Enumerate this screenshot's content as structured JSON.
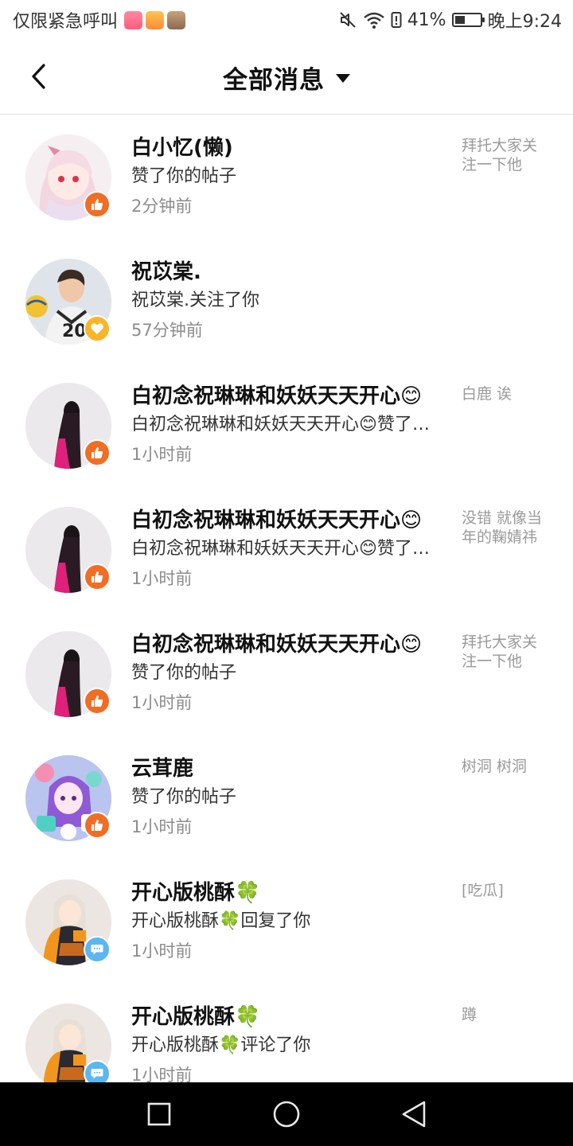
{
  "status_bar": {
    "carrier": "仅限紧急呼叫",
    "battery_percent": "41%",
    "battery_level": 0.41,
    "time": "晚上9:24",
    "notification_icons": [
      "app-notification-icon",
      "app-notification-icon",
      "app-notification-icon"
    ]
  },
  "header": {
    "title": "全部消息"
  },
  "messages": [
    {
      "name": "白小忆(懒)",
      "action": "赞了你的帖子",
      "time": "2分钟前",
      "preview": "拜托大家关注一下他",
      "badge": "like",
      "avatar": "anime-girl-pink-hair"
    },
    {
      "name": "祝苡棠.",
      "action": "祝苡棠.关注了你",
      "time": "57分钟前",
      "preview": "",
      "badge": "follow",
      "avatar": "volleyball-player"
    },
    {
      "name": "白初念祝琳琳和妖妖天天开心😊",
      "action": "白初念祝琳琳和妖妖天天开心😊赞了你的评论",
      "time": "1小时前",
      "preview": "白鹿 诶",
      "badge": "like",
      "avatar": "long-hair-silhouette"
    },
    {
      "name": "白初念祝琳琳和妖妖天天开心😊",
      "action": "白初念祝琳琳和妖妖天天开心😊赞了你的评论",
      "time": "1小时前",
      "preview": "没错 就像当年的鞠婧祎一样",
      "badge": "like",
      "avatar": "long-hair-silhouette"
    },
    {
      "name": "白初念祝琳琳和妖妖天天开心😊",
      "action": "赞了你的帖子",
      "time": "1小时前",
      "preview": "拜托大家关注一下他",
      "badge": "like",
      "avatar": "long-hair-silhouette"
    },
    {
      "name": "云茸鹿",
      "action": "赞了你的帖子",
      "time": "1小时前",
      "preview": "树洞 树洞",
      "badge": "like",
      "avatar": "colorful-anime-collage"
    },
    {
      "name": "开心版桃酥🍀",
      "action": "开心版桃酥🍀回复了你",
      "time": "1小时前",
      "preview": "[吃瓜]",
      "badge": "comment",
      "avatar": "anime-girl-orange-jacket"
    },
    {
      "name": "开心版桃酥🍀",
      "action": "开心版桃酥🍀评论了你",
      "time": "1小时前",
      "preview": "蹲",
      "badge": "comment",
      "avatar": "anime-girl-orange-jacket"
    }
  ],
  "icons": {
    "back": "chevron-left-icon",
    "dropdown": "caret-down-icon",
    "like": "thumbs-up-icon",
    "follow": "heart-icon",
    "comment": "chat-bubble-icon",
    "nav_recent": "square-icon",
    "nav_home": "circle-icon",
    "nav_back": "triangle-back-icon"
  },
  "colors": {
    "like_badge": "#f26d24",
    "follow_badge": "#f9b52a",
    "comment_badge": "#5ab7f0",
    "time_text": "#8c8c8c",
    "preview_text": "#9a9a9a"
  }
}
